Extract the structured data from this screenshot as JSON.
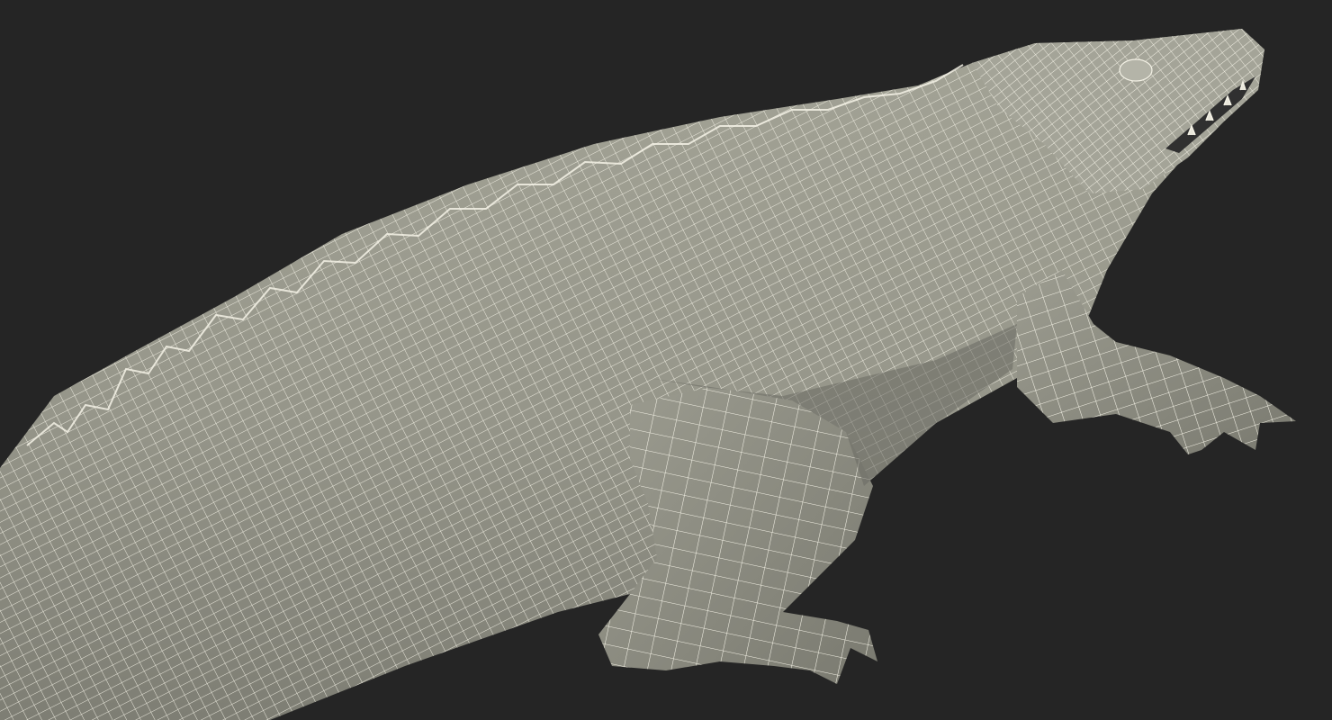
{
  "scene": {
    "subject": "alligator-wireframe-model",
    "background_color": "#252525",
    "mesh_fill_color": "#9a9a8d",
    "mesh_shadow_color": "#74746a",
    "wire_color": "#f4f2e6"
  }
}
